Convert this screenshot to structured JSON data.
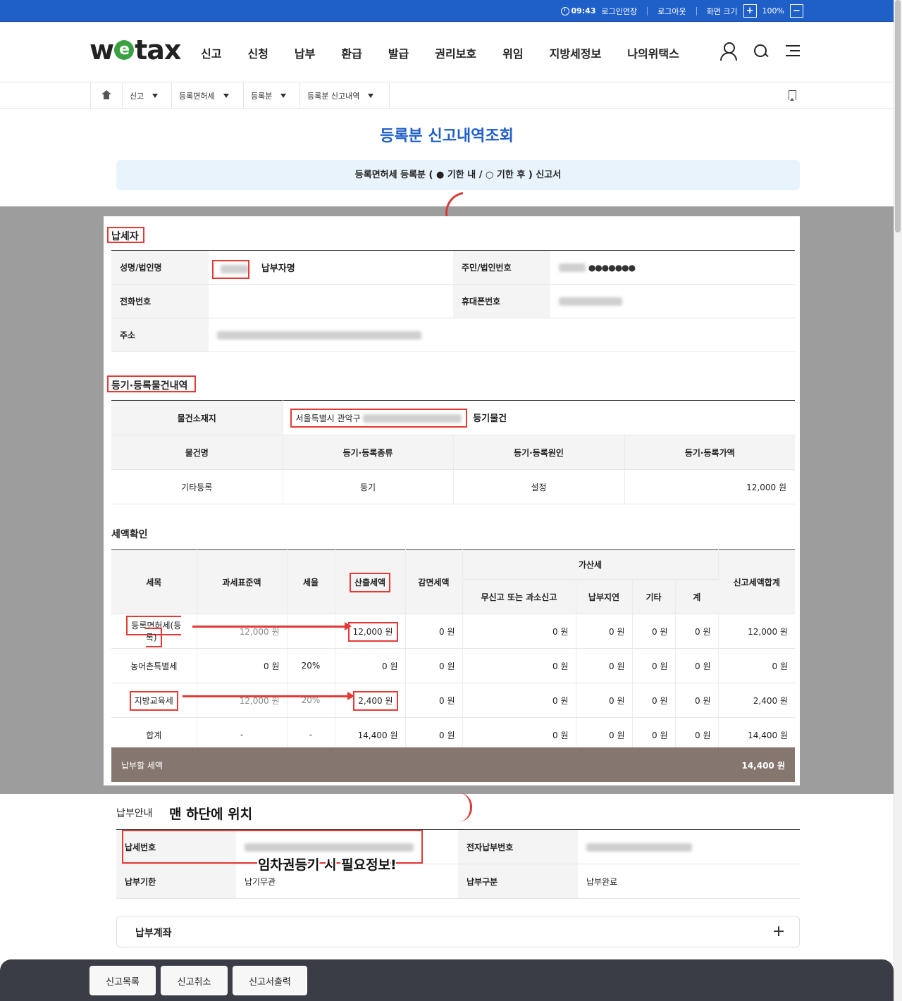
{
  "util": {
    "time": "09:43",
    "extend": "로그인연장",
    "logout": "로그아웃",
    "screen_size": "화면 크기",
    "zoom": "100%",
    "plus": "+",
    "minus": "−"
  },
  "header": {
    "logo_pre": "w",
    "logo_e": "e",
    "logo_post": "tax",
    "nav": [
      "신고",
      "신청",
      "납부",
      "환급",
      "발급",
      "권리보호",
      "위임",
      "지방세정보",
      "나의위택스"
    ]
  },
  "breadcrumb": {
    "items": [
      "신고",
      "등록면허세",
      "등록분",
      "등록분 신고내역"
    ]
  },
  "page": {
    "title": "등록분 신고내역조회",
    "notice": "등록면허세 등록분 ( ● 기한 내 / ○ 기한 후 ) 신고서"
  },
  "taxpayer": {
    "section": "납세자",
    "name_label": "성명/법인명",
    "name_annotation": "납부자명",
    "id_label": "주민/법인번호",
    "id_masked": "●●●●●●●",
    "phone_label": "전화번호",
    "mobile_label": "휴대폰번호",
    "address_label": "주소"
  },
  "object": {
    "section": "등기·등록물건내역",
    "location_label": "물건소재지",
    "location_value": "서울특별시 관악구",
    "location_annotation": "등기물건",
    "headers": [
      "물건명",
      "등기·등록종류",
      "등기·등록원인",
      "등기·등록가액"
    ],
    "row": [
      "기타등록",
      "등기",
      "설정",
      "12,000 원"
    ]
  },
  "tax": {
    "section": "세액확인",
    "h_item": "세목",
    "h_base": "과세표준액",
    "h_rate": "세율",
    "h_calc": "산출세액",
    "h_reduce": "감면세액",
    "h_add": "가산세",
    "h_add_none": "무신고 또는 과소신고",
    "h_add_late": "납부지연",
    "h_add_etc": "기타",
    "h_add_sum": "계",
    "h_total": "신고세액합계",
    "rows": [
      [
        "등록면허세(등록)",
        "12,000 원",
        "",
        "12,000 원",
        "0 원",
        "0 원",
        "0 원",
        "0 원",
        "0 원",
        "12,000 원"
      ],
      [
        "농어촌특별세",
        "0 원",
        "20%",
        "0 원",
        "0 원",
        "0 원",
        "0 원",
        "0 원",
        "0 원",
        "0 원"
      ],
      [
        "지방교육세",
        "12,000 원",
        "20%",
        "2,400 원",
        "0 원",
        "0 원",
        "0 원",
        "0 원",
        "0 원",
        "2,400 원"
      ],
      [
        "합계",
        "-",
        "-",
        "14,400 원",
        "0 원",
        "0 원",
        "0 원",
        "0 원",
        "0 원",
        "14,400 원"
      ]
    ],
    "pay_label": "납부할 세액",
    "pay_value": "14,400 원"
  },
  "payment": {
    "section": "납부안내",
    "annotation_bottom": "맨 하단에 위치",
    "annotation_needed": "임차권등기 시 필요정보!",
    "tax_no_label": "납세번호",
    "e_no_label": "전자납부번호",
    "due_label": "납부기한",
    "due_value": "납기무관",
    "type_label": "납부구분",
    "type_value": "납부완료",
    "account_label": "납부계좌"
  },
  "buttons": {
    "list": "신고목록",
    "cancel": "신고취소",
    "print": "신고서출력"
  }
}
